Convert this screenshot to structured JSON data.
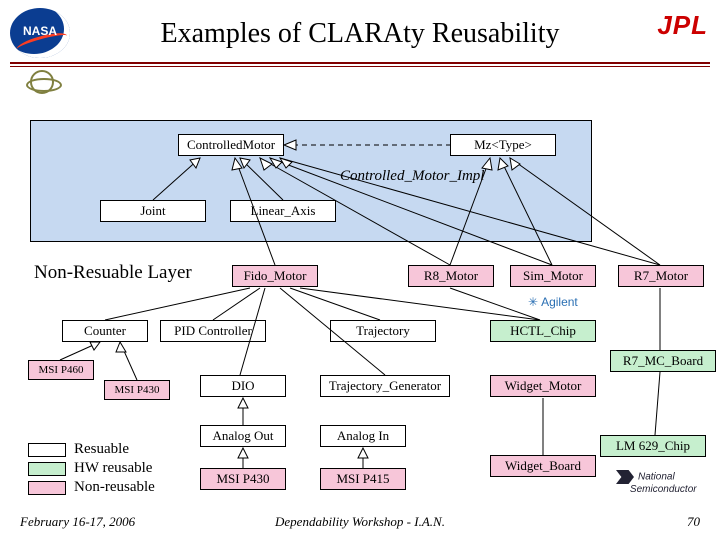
{
  "title": "Examples of CLARAty Reusability",
  "logos": {
    "nasa": "NASA",
    "jpl": "JPL"
  },
  "blue_band": {
    "controlled_motor": "ControlledMotor",
    "mz_type": "Mz<Type>",
    "impl": "Controlled_Motor_Impl",
    "joint": "Joint",
    "linear_axis": "Linear_Axis"
  },
  "section_label": "Non-Resuable Layer",
  "row_motors": {
    "fido": "Fido_Motor",
    "r8": "R8_Motor",
    "sim": "Sim_Motor",
    "r7": "R7_Motor"
  },
  "row_ctrl": {
    "counter": "Counter",
    "pid": "PID Controller",
    "trajectory": "Trajectory",
    "hctl": "HCTL_Chip"
  },
  "row_gen": {
    "msip460": "MSI P460",
    "msip430a": "MSI P430",
    "dio": "DIO",
    "traj_gen": "Trajectory_Generator",
    "widget_motor": "Widget_Motor",
    "r7_mc": "R7_MC_Board"
  },
  "row_io": {
    "analog_out": "Analog Out",
    "analog_in": "Analog In",
    "lm629": "LM 629_Chip"
  },
  "row_last": {
    "msip430b": "MSI P430",
    "msip415": "MSI P415",
    "widget_board": "Widget_Board"
  },
  "legend": {
    "reusable": "Resuable",
    "hw": "HW reusable",
    "non": "Non-reusable"
  },
  "vendors": {
    "agilent": "Agilent",
    "natsemi_a": "National",
    "natsemi_b": "Semiconductor"
  },
  "footer": {
    "left": "February 16-17, 2006",
    "center": "Dependability Workshop - I.A.N.",
    "right": "70"
  }
}
